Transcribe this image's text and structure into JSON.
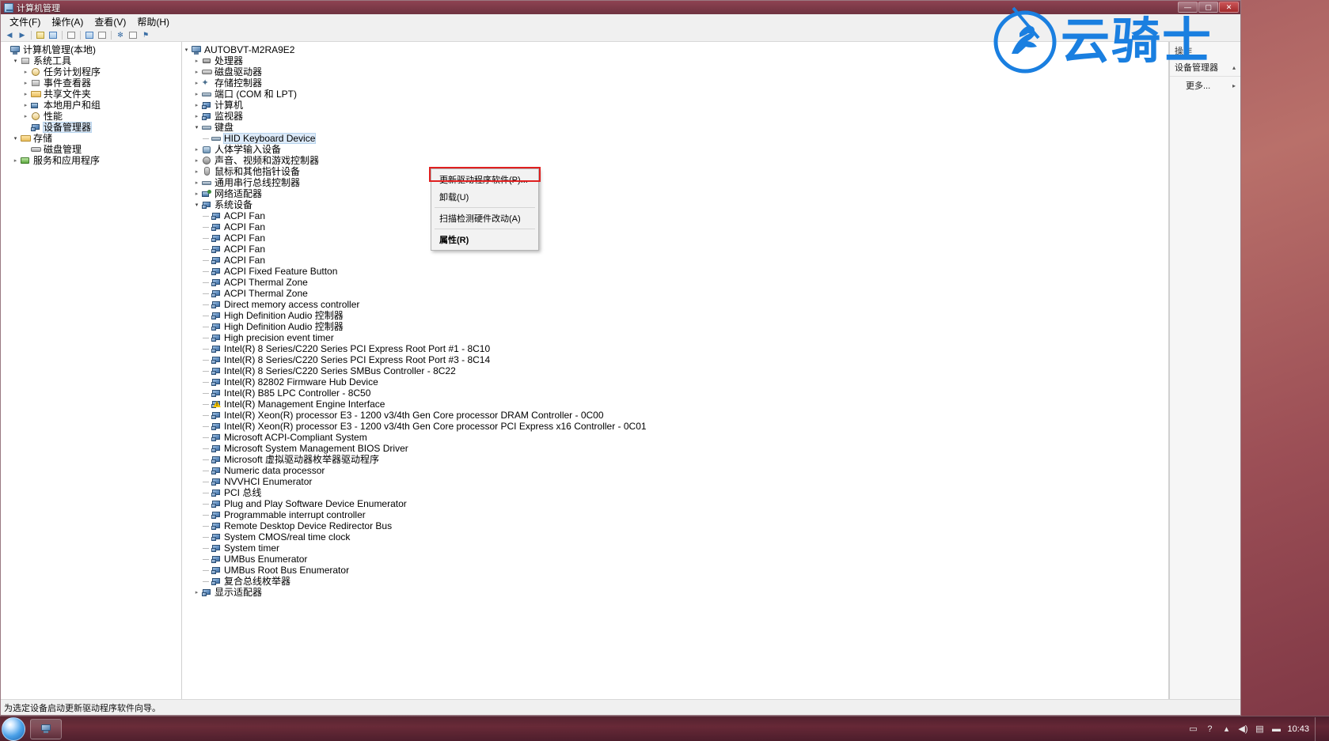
{
  "window": {
    "title": "计算机管理",
    "buttons": {
      "minimize": "—",
      "maximize": "▢",
      "close": "✕"
    }
  },
  "menubar": [
    {
      "label": "文件(F)"
    },
    {
      "label": "操作(A)"
    },
    {
      "label": "查看(V)"
    },
    {
      "label": "帮助(H)"
    }
  ],
  "sidebar": [
    {
      "label": "计算机管理(本地)",
      "indent": 0,
      "icon": "computer-icon",
      "expander": ""
    },
    {
      "label": "系统工具",
      "indent": 1,
      "icon": "folder-tools-icon",
      "expander": "▾"
    },
    {
      "label": "任务计划程序",
      "indent": 2,
      "icon": "clock-icon",
      "expander": "▸"
    },
    {
      "label": "事件查看器",
      "indent": 2,
      "icon": "event-icon",
      "expander": "▸"
    },
    {
      "label": "共享文件夹",
      "indent": 2,
      "icon": "folder-icon",
      "expander": "▸"
    },
    {
      "label": "本地用户和组",
      "indent": 2,
      "icon": "users-icon",
      "expander": "▸"
    },
    {
      "label": "性能",
      "indent": 2,
      "icon": "performance-icon",
      "expander": "▸"
    },
    {
      "label": "设备管理器",
      "indent": 2,
      "icon": "device-manager-icon",
      "expander": "",
      "selected": true
    },
    {
      "label": "存储",
      "indent": 1,
      "icon": "storage-icon",
      "expander": "▾"
    },
    {
      "label": "磁盘管理",
      "indent": 2,
      "icon": "disk-icon",
      "expander": ""
    },
    {
      "label": "服务和应用程序",
      "indent": 1,
      "icon": "services-icon",
      "expander": "▸"
    }
  ],
  "tree": {
    "root": {
      "label": "AUTOBVT-M2RA9E2",
      "icon": "computer-icon",
      "expander": "▾"
    },
    "categories": [
      {
        "label": "处理器",
        "icon": "chip-icon",
        "expander": "▸"
      },
      {
        "label": "磁盘驱动器",
        "icon": "disk-icon",
        "expander": "▸"
      },
      {
        "label": "存储控制器",
        "icon": "storage-controller-icon",
        "expander": "▸"
      },
      {
        "label": "端口 (COM 和 LPT)",
        "icon": "port-icon",
        "expander": "▸"
      },
      {
        "label": "计算机",
        "icon": "device-icon",
        "expander": "▸"
      },
      {
        "label": "监视器",
        "icon": "device-icon",
        "expander": "▸"
      },
      {
        "label": "键盘",
        "icon": "keyboard-icon",
        "expander": "▾"
      },
      {
        "label": "HID Keyboard Device",
        "icon": "keyboard-icon",
        "expander": "",
        "child": true,
        "selected": true
      },
      {
        "label": "人体学输入设备",
        "icon": "human-interface-icon",
        "expander": "▸"
      },
      {
        "label": "声音、视频和游戏控制器",
        "icon": "speaker-icon",
        "expander": "▸"
      },
      {
        "label": "鼠标和其他指针设备",
        "icon": "mouse-icon",
        "expander": "▸"
      },
      {
        "label": "通用串行总线控制器",
        "icon": "usb-icon",
        "expander": "▸"
      },
      {
        "label": "网络适配器",
        "icon": "network-icon",
        "expander": "▸"
      },
      {
        "label": "系统设备",
        "icon": "device-icon",
        "expander": "▾"
      }
    ],
    "system_devices": [
      {
        "label": "ACPI Fan",
        "warn": false
      },
      {
        "label": "ACPI Fan",
        "warn": false
      },
      {
        "label": "ACPI Fan",
        "warn": false
      },
      {
        "label": "ACPI Fan",
        "warn": false
      },
      {
        "label": "ACPI Fan",
        "warn": false
      },
      {
        "label": "ACPI Fixed Feature Button",
        "warn": false
      },
      {
        "label": "ACPI Thermal Zone",
        "warn": false
      },
      {
        "label": "ACPI Thermal Zone",
        "warn": false
      },
      {
        "label": "Direct memory access controller",
        "warn": false
      },
      {
        "label": "High Definition Audio 控制器",
        "warn": false
      },
      {
        "label": "High Definition Audio 控制器",
        "warn": false
      },
      {
        "label": "High precision event timer",
        "warn": false
      },
      {
        "label": "Intel(R) 8 Series/C220 Series PCI Express Root Port #1 - 8C10",
        "warn": false
      },
      {
        "label": "Intel(R) 8 Series/C220 Series PCI Express Root Port #3 - 8C14",
        "warn": false
      },
      {
        "label": "Intel(R) 8 Series/C220 Series SMBus Controller - 8C22",
        "warn": false
      },
      {
        "label": "Intel(R) 82802 Firmware Hub Device",
        "warn": false
      },
      {
        "label": "Intel(R) B85 LPC Controller - 8C50",
        "warn": false
      },
      {
        "label": "Intel(R) Management Engine Interface",
        "warn": true
      },
      {
        "label": "Intel(R) Xeon(R) processor E3 - 1200 v3/4th Gen Core processor DRAM Controller - 0C00",
        "warn": false
      },
      {
        "label": "Intel(R) Xeon(R) processor E3 - 1200 v3/4th Gen Core processor PCI Express x16 Controller - 0C01",
        "warn": false
      },
      {
        "label": "Microsoft ACPI-Compliant System",
        "warn": false
      },
      {
        "label": "Microsoft System Management BIOS Driver",
        "warn": false
      },
      {
        "label": "Microsoft 虚拟驱动器枚举器驱动程序",
        "warn": false
      },
      {
        "label": "Numeric data processor",
        "warn": false
      },
      {
        "label": "NVVHCI Enumerator",
        "warn": false
      },
      {
        "label": "PCI 总线",
        "warn": false
      },
      {
        "label": "Plug and Play Software Device Enumerator",
        "warn": false
      },
      {
        "label": "Programmable interrupt controller",
        "warn": false
      },
      {
        "label": "Remote Desktop Device Redirector Bus",
        "warn": false
      },
      {
        "label": "System CMOS/real time clock",
        "warn": false
      },
      {
        "label": "System timer",
        "warn": false
      },
      {
        "label": "UMBus Enumerator",
        "warn": false
      },
      {
        "label": "UMBus Root Bus Enumerator",
        "warn": false
      },
      {
        "label": "复合总线枚举器",
        "warn": false
      }
    ],
    "trailing": [
      {
        "label": "显示适配器",
        "icon": "display-adapter-icon",
        "expander": "▸"
      }
    ]
  },
  "context_menu": {
    "items": [
      {
        "label": "更新驱动程序软件(P)...",
        "highlighted": true,
        "bold": false
      },
      {
        "label": "卸载(U)",
        "highlighted": false,
        "bold": false
      },
      {
        "label": "扫描检测硬件改动(A)",
        "highlighted": false,
        "bold": false
      },
      {
        "label": "属性(R)",
        "highlighted": false,
        "bold": true
      }
    ],
    "highlight_color": "#e02020"
  },
  "actions_pane": {
    "header": "操作",
    "section": "设备管理器",
    "section_arrow": "▴",
    "items": [
      {
        "label": "更多...",
        "arrow": "▸"
      }
    ]
  },
  "statusbar": {
    "text": "为选定设备启动更新驱动程序软件向导。"
  },
  "watermark": {
    "text": "云骑士",
    "color": "#1a7fe0"
  },
  "taskbar": {
    "clock_time": "10:43",
    "tray_icons": [
      "flag-icon",
      "help-icon",
      "action-center-icon",
      "show-hidden-icon",
      "volume-icon",
      "network-icon",
      "battery-icon"
    ]
  },
  "toolbar": {
    "icons": [
      "back-icon",
      "forward-icon",
      "up-icon",
      "show-tree-icon",
      "list-icon",
      "properties-icon",
      "help-icon",
      "refresh-icon",
      "export-icon",
      "scan-icon"
    ]
  }
}
